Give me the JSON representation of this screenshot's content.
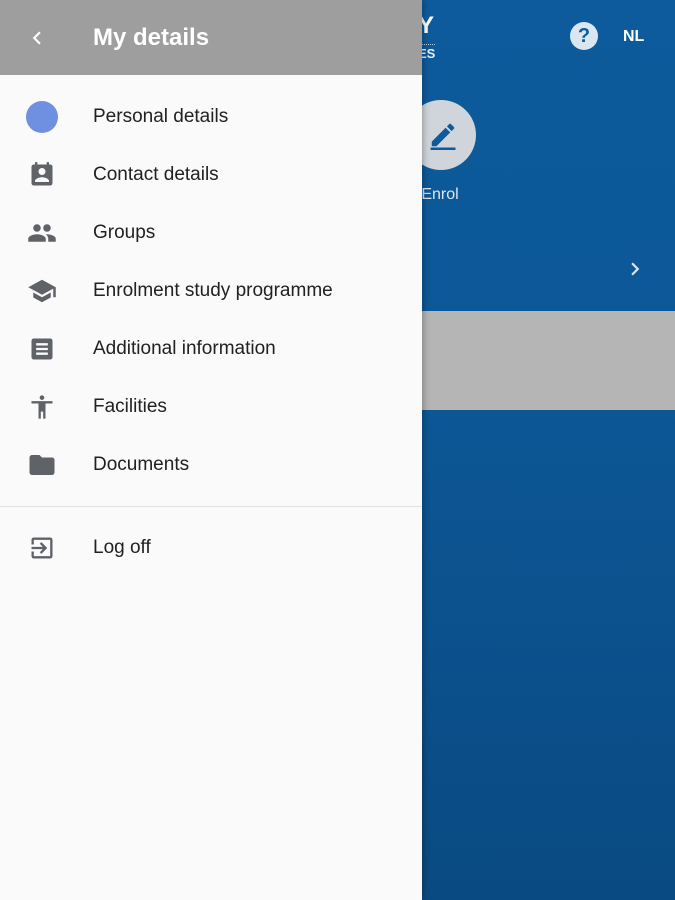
{
  "background": {
    "logo_top": "Y",
    "logo_bottom": "ES",
    "help_icon": "help-circle-icon",
    "help_symbol": "?",
    "language": "NL",
    "enrol_label": "Enrol",
    "colors": {
      "primary_blue": "#0d5b9c",
      "band_grey": "#b5b5b5"
    }
  },
  "drawer": {
    "title": "My details",
    "back_icon": "chevron-left-icon",
    "items": [
      {
        "label": "Personal details",
        "icon": "avatar-dot-icon"
      },
      {
        "label": "Contact details",
        "icon": "contact-card-icon"
      },
      {
        "label": "Groups",
        "icon": "people-icon"
      },
      {
        "label": "Enrolment study programme",
        "icon": "graduation-cap-icon"
      },
      {
        "label": "Additional information",
        "icon": "notes-icon"
      },
      {
        "label": "Facilities",
        "icon": "accessibility-icon"
      },
      {
        "label": "Documents",
        "icon": "folder-icon"
      }
    ],
    "logoff": {
      "label": "Log off",
      "icon": "exit-icon"
    },
    "colors": {
      "header_bg": "#9e9e9e",
      "avatar": "#6f8fe0",
      "icon": "#5f6368"
    }
  }
}
